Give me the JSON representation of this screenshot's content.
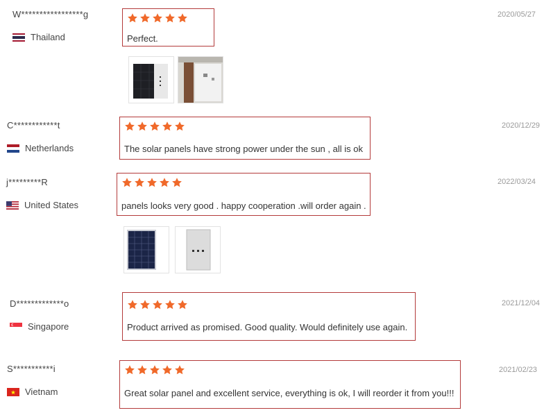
{
  "colors": {
    "star": "#f0692a",
    "box_border": "#b33a3a",
    "date": "#9a9a9a"
  },
  "icons": {
    "star": "star-icon",
    "flags": [
      "flag-thailand-icon",
      "flag-netherlands-icon",
      "flag-united-states-icon",
      "flag-singapore-icon",
      "flag-vietnam-icon"
    ]
  },
  "reviews": [
    {
      "user": "W*****************g",
      "country": "Thailand",
      "rating": 5,
      "text": "Perfect.",
      "date": "2020/05/27",
      "photos": [
        "solar-panel-photo",
        "installed-panel-photo"
      ]
    },
    {
      "user": "C************t",
      "country": "Netherlands",
      "rating": 5,
      "text": "The solar panels have strong power under the sun , all is ok",
      "date": "2020/12/29",
      "photos": []
    },
    {
      "user": "j*********R",
      "country": "United States",
      "rating": 5,
      "text": "panels looks very good . happy cooperation .will order again .",
      "date": "2022/03/24",
      "photos": [
        "solar-panel-front-photo",
        "solar-panel-back-photo"
      ]
    },
    {
      "user": "D*************o",
      "country": "Singapore",
      "rating": 5,
      "text": "Product arrived as promised. Good quality. Would definitely use again.",
      "date": "2021/12/04",
      "photos": []
    },
    {
      "user": "S***********i",
      "country": "Vietnam",
      "rating": 5,
      "text": "Great solar panel and excellent service, everything is ok, I will reorder it from you!!!",
      "date": "2021/02/23",
      "photos": []
    }
  ]
}
